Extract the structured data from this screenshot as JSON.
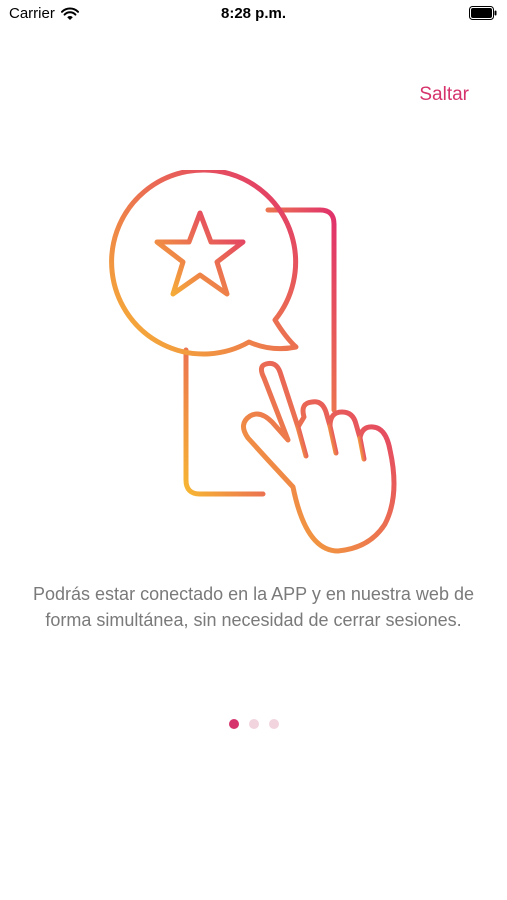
{
  "status_bar": {
    "carrier": "Carrier",
    "time": "8:28 p.m."
  },
  "onboarding": {
    "skip_label": "Saltar",
    "description": "Podrás estar conectado en la APP y en nuestra web de forma simultánea, sin necesidad de cerrar sesiones.",
    "illustration_icons": [
      "smartphone-icon",
      "star-speech-bubble-icon",
      "tapping-hand-icon"
    ],
    "page_indicator": {
      "total": 3,
      "current": 1
    }
  },
  "colors": {
    "accent": "#d6336c",
    "gradient_start": "#f7b733",
    "gradient_end": "#e0306c",
    "description_text": "#7a7a7a",
    "dot_active": "#d6336c",
    "dot_inactive": "#f1d4de"
  }
}
